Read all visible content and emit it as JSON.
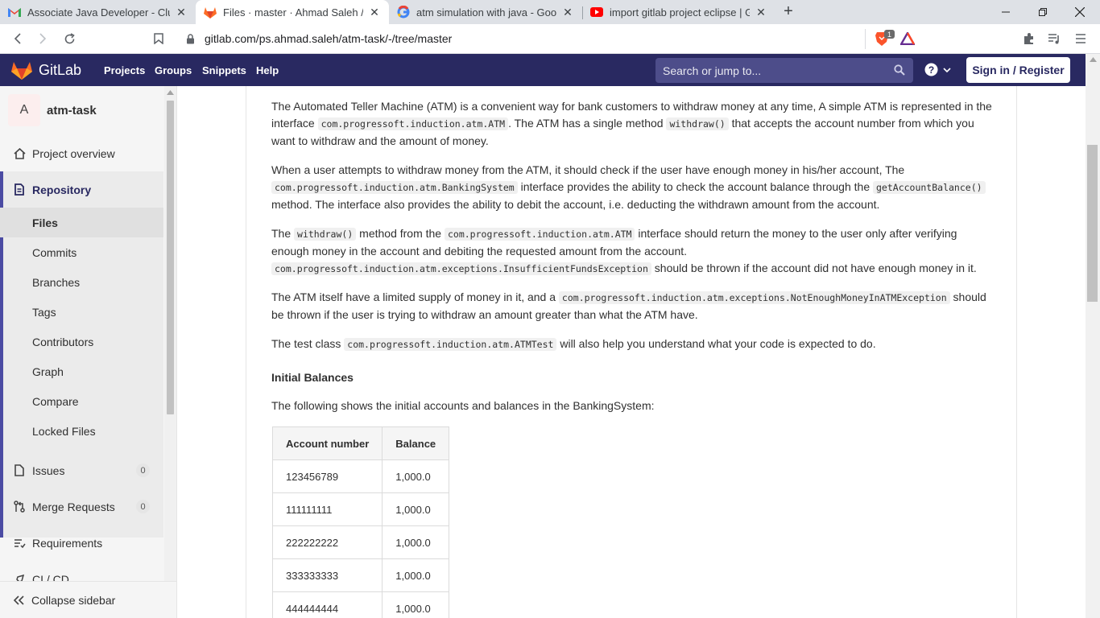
{
  "browser": {
    "tabs": [
      {
        "title": "Associate Java Developer - Clusus",
        "icon": "gmail-icon"
      },
      {
        "title": "Files · master · Ahmad Saleh / atm-",
        "icon": "gitlab-icon"
      },
      {
        "title": "atm simulation with java - Google",
        "icon": "google-icon"
      },
      {
        "title": "import gitlab project eclipse | Gitla",
        "icon": "youtube-icon"
      }
    ],
    "url": "gitlab.com/ps.ahmad.saleh/atm-task/-/tree/master",
    "brave_badge": "1"
  },
  "header": {
    "brand": "GitLab",
    "nav": [
      "Projects",
      "Groups",
      "Snippets",
      "Help"
    ],
    "search_placeholder": "Search or jump to...",
    "signin_label": "Sign in / Register",
    "colors": {
      "header_bg": "#292961",
      "accent": "#4b4ba3"
    }
  },
  "sidebar": {
    "project_initial": "A",
    "project_name": "atm-task",
    "overview": "Project overview",
    "repository": "Repository",
    "repo_items": [
      "Files",
      "Commits",
      "Branches",
      "Tags",
      "Contributors",
      "Graph",
      "Compare",
      "Locked Files"
    ],
    "issues": {
      "label": "Issues",
      "count": "0"
    },
    "merge_requests": {
      "label": "Merge Requests",
      "count": "0"
    },
    "requirements": "Requirements",
    "cicd": "CI / CD",
    "collapse": "Collapse sidebar"
  },
  "content": {
    "p1": {
      "a": "The Automated Teller Machine (ATM) is a convenient way for bank customers to withdraw money at any time, A simple ATM is represented in the interface ",
      "code1": "com.progressoft.induction.atm.ATM",
      "b": ". The ATM has a single method ",
      "code2": "withdraw()",
      "c": " that accepts the account number from which you want to withdraw and the amount of money."
    },
    "p2": {
      "a": "When a user attempts to withdraw money from the ATM, it should check if the user have enough money in his/her account, The ",
      "code1": "com.progressoft.induction.atm.BankingSystem",
      "b": " interface provides the ability to check the account balance through the ",
      "code2": "getAccountBalance()",
      "c": " method. The interface also provides the ability to debit the account, i.e. deducting the withdrawn amount from the account."
    },
    "p3": {
      "a": "The ",
      "code1": "withdraw()",
      "b": " method from the ",
      "code2": "com.progressoft.induction.atm.ATM",
      "c": " interface should return the money to the user only after verifying enough money in the account and debiting the requested amount from the account. ",
      "code3": "com.progressoft.induction.atm.exceptions.InsufficientFundsException",
      "d": " should be thrown if the account did not have enough money in it."
    },
    "p4": {
      "a": "The ATM itself have a limited supply of money in it, and a ",
      "code1": "com.progressoft.induction.atm.exceptions.NotEnoughMoneyInATMException",
      "b": " should be thrown if the user is trying to withdraw an amount greater than what the ATM have."
    },
    "p5": {
      "a": "The test class ",
      "code1": "com.progressoft.induction.atm.ATMTest",
      "b": " will also help you understand what your code is expected to do."
    },
    "heading": "Initial Balances",
    "p6": "The following shows the initial accounts and balances in the BankingSystem:",
    "table": {
      "headers": [
        "Account number",
        "Balance"
      ],
      "rows": [
        [
          "123456789",
          "1,000.0"
        ],
        [
          "111111111",
          "1,000.0"
        ],
        [
          "222222222",
          "1,000.0"
        ],
        [
          "333333333",
          "1,000.0"
        ],
        [
          "444444444",
          "1,000.0"
        ]
      ]
    }
  }
}
